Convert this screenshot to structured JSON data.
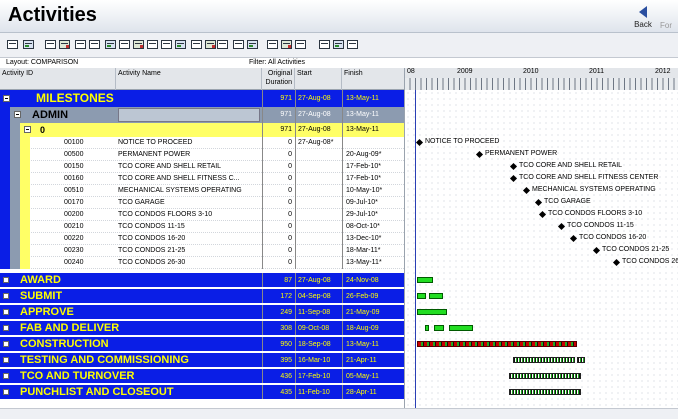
{
  "header": {
    "title": "Activities",
    "back_label": "Back",
    "forward_label": "For"
  },
  "toolbar": {
    "icons": [
      "print-icon",
      "print-preview-icon",
      "columns-icon",
      "table-icon",
      "relationship-icon",
      "wbs-icon",
      "layout-icon",
      "gantt-icon",
      "bars-icon",
      "tracking-icon",
      "trace-logic-icon",
      "progress-icon",
      "spotlight-icon",
      "filter-icon",
      "group-sort-icon",
      "view-icon",
      "save-layout-icon",
      "schedule-icon",
      "level-icon",
      "refresh-icon",
      "zoom-in-icon",
      "zoom-out-icon",
      "zoom-fit-icon"
    ]
  },
  "layout_label": "Layout: COMPARISON",
  "filter_label": "Filter: All Activities",
  "columns": {
    "activity_id": "Activity ID",
    "activity_name": "Activity Name",
    "duration_l1": "Original",
    "duration_l2": "Duration",
    "start": "Start",
    "finish": "Finish"
  },
  "timeline": {
    "years": [
      "08",
      "2009",
      "2010",
      "2011",
      "2012"
    ]
  },
  "groups_top": [
    {
      "label": "MILESTONES",
      "duration": "971",
      "start": "27-Aug-08",
      "finish": "13-May-11"
    },
    {
      "label": "ADMIN",
      "duration": "971",
      "start": "27-Aug-08",
      "finish": "13-May-11"
    },
    {
      "label": "0",
      "duration": "971",
      "start": "27-Aug-08",
      "finish": "13-May-11"
    }
  ],
  "activities": [
    {
      "id": "00100",
      "name": "NOTICE TO PROCEED",
      "duration": "0",
      "start": "27-Aug-08*",
      "finish": "",
      "label": "NOTICE TO PROCEED"
    },
    {
      "id": "00500",
      "name": "PERMANENT POWER",
      "duration": "0",
      "start": "",
      "finish": "20-Aug-09*",
      "label": "PERMANENT POWER"
    },
    {
      "id": "00150",
      "name": "TCO CORE AND SHELL RETAIL",
      "duration": "0",
      "start": "",
      "finish": "17-Feb-10*",
      "label": "TCO CORE AND SHELL RETAIL"
    },
    {
      "id": "00160",
      "name": "TCO CORE AND SHELL FITNESS C...",
      "duration": "0",
      "start": "",
      "finish": "17-Feb-10*",
      "label": "TCO CORE AND SHELL FITNESS CENTER"
    },
    {
      "id": "00510",
      "name": "MECHANICAL SYSTEMS OPERATING",
      "duration": "0",
      "start": "",
      "finish": "10-May-10*",
      "label": "MECHANICAL SYSTEMS OPERATING"
    },
    {
      "id": "00170",
      "name": "TCO GARAGE",
      "duration": "0",
      "start": "",
      "finish": "09-Jul-10*",
      "label": "TCO GARAGE"
    },
    {
      "id": "00200",
      "name": "TCO CONDOS FLOORS 3-10",
      "duration": "0",
      "start": "",
      "finish": "29-Jul-10*",
      "label": "TCO CONDOS FLOORS 3-10"
    },
    {
      "id": "00210",
      "name": "TCO CONDOS 11-15",
      "duration": "0",
      "start": "",
      "finish": "08-Oct-10*",
      "label": "TCO CONDOS 11-15"
    },
    {
      "id": "00220",
      "name": "TCO CONDOS 16-20",
      "duration": "0",
      "start": "",
      "finish": "13-Dec-10*",
      "label": "TCO CONDOS 16-20"
    },
    {
      "id": "00230",
      "name": "TCO CONDOS 21-25",
      "duration": "0",
      "start": "",
      "finish": "18-Mar-11*",
      "label": "TCO CONDOS 21-25"
    },
    {
      "id": "00240",
      "name": "TCO CONDOS 26-30",
      "duration": "0",
      "start": "",
      "finish": "13-May-11*",
      "label": "TCO CONDOS 26-30"
    }
  ],
  "groups_bottom": [
    {
      "label": "AWARD",
      "duration": "87",
      "start": "27-Aug-08",
      "finish": "24-Nov-08"
    },
    {
      "label": "SUBMIT",
      "duration": "172",
      "start": "04-Sep-08",
      "finish": "26-Feb-09"
    },
    {
      "label": "APPROVE",
      "duration": "249",
      "start": "11-Sep-08",
      "finish": "21-May-09"
    },
    {
      "label": "FAB AND DELIVER",
      "duration": "308",
      "start": "09-Oct-08",
      "finish": "18-Aug-09"
    },
    {
      "label": "CONSTRUCTION",
      "duration": "950",
      "start": "18-Sep-08",
      "finish": "13-May-11"
    },
    {
      "label": "TESTING AND COMMISSIONING",
      "duration": "395",
      "start": "16-Mar-10",
      "finish": "21-Apr-11"
    },
    {
      "label": "TCO AND TURNOVER",
      "duration": "436",
      "start": "17-Feb-10",
      "finish": "05-May-11"
    },
    {
      "label": "PUNCHLIST AND CLOSEOUT",
      "duration": "435",
      "start": "11-Feb-10",
      "finish": "28-Apr-11"
    }
  ],
  "colors": {
    "group_blue": "#0a1ee6",
    "group_text": "#ffff00",
    "wbs_yellow": "#ffff66",
    "bar_green": "#22dd22",
    "critical_red": "#cc0000"
  }
}
